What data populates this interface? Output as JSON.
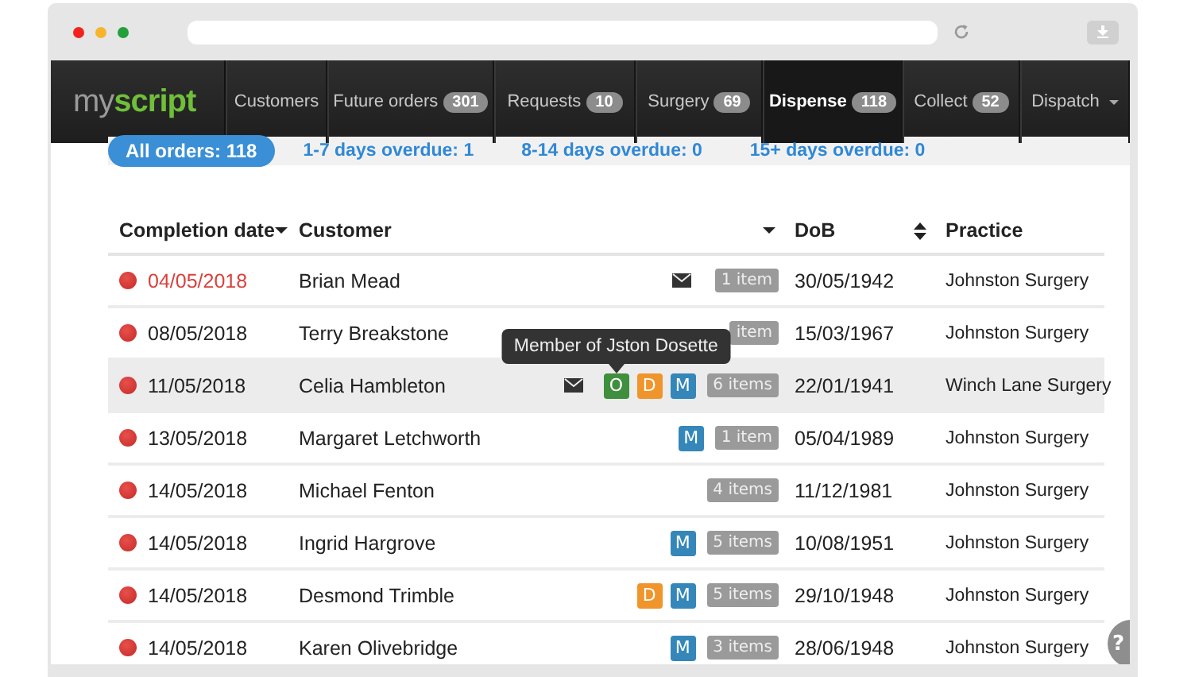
{
  "nav": {
    "logo": [
      "my",
      "script"
    ],
    "items": [
      {
        "label": "Customers",
        "selected": false
      },
      {
        "label": "Future orders",
        "count": "301",
        "selected": false
      },
      {
        "label": "Requests",
        "count": "10",
        "selected": false
      },
      {
        "label": "Surgery",
        "count": "69",
        "selected": false
      },
      {
        "label": "Dispense",
        "count": "118",
        "selected": true
      },
      {
        "label": "Collect",
        "count": "52",
        "selected": false
      },
      {
        "label": "Dispatch",
        "has_menu": true,
        "selected": false
      }
    ]
  },
  "filters": [
    {
      "label": "All orders: 118",
      "selected": true
    },
    {
      "label": "1-7 days overdue: 1",
      "selected": false
    },
    {
      "label": "8-14 days overdue: 0",
      "selected": false
    },
    {
      "label": "15+ days overdue: 0",
      "selected": false
    }
  ],
  "table": {
    "columns": [
      {
        "label": "Completion date",
        "sorted": true
      },
      {
        "label": "Customer",
        "sorted": true
      },
      {
        "label": "DoB",
        "sorted": false,
        "sortable": true
      },
      {
        "label": "Practice"
      }
    ],
    "rows": [
      {
        "date": "04/05/2018",
        "overdue": true,
        "customer": "Brian Mead",
        "mail": true,
        "tags": [],
        "items": "1 item",
        "dob": "30/05/1942",
        "practice": "Johnston Surgery",
        "highlighted": false
      },
      {
        "date": "08/05/2018",
        "overdue": false,
        "customer": "Terry Breakstone",
        "mail": false,
        "tags": [],
        "items": "item",
        "dob": "15/03/1967",
        "practice": "Johnston Surgery",
        "highlighted": false
      },
      {
        "date": "11/05/2018",
        "overdue": false,
        "customer": "Celia Hambleton",
        "mail": true,
        "tags": [
          {
            "letter": "O",
            "color": "#3f8f3f",
            "tooltip": "Member of Jston Dosette"
          },
          {
            "letter": "D",
            "color": "#f0952b"
          },
          {
            "letter": "M",
            "color": "#3487b8"
          }
        ],
        "items": "6 items",
        "dob": "22/01/1941",
        "practice": "Winch Lane Surgery",
        "highlighted": true
      },
      {
        "date": "13/05/2018",
        "overdue": false,
        "customer": "Margaret Letchworth",
        "mail": false,
        "tags": [
          {
            "letter": "M",
            "color": "#3487b8"
          }
        ],
        "items": "1 item",
        "dob": "05/04/1989",
        "practice": "Johnston Surgery",
        "highlighted": false
      },
      {
        "date": "14/05/2018",
        "overdue": false,
        "customer": "Michael Fenton",
        "mail": false,
        "tags": [],
        "items": "4 items",
        "dob": "11/12/1981",
        "practice": "Johnston Surgery",
        "highlighted": false
      },
      {
        "date": "14/05/2018",
        "overdue": false,
        "customer": "Ingrid Hargrove",
        "mail": false,
        "tags": [
          {
            "letter": "M",
            "color": "#3487b8"
          }
        ],
        "items": "5 items",
        "dob": "10/08/1951",
        "practice": "Johnston Surgery",
        "highlighted": false
      },
      {
        "date": "14/05/2018",
        "overdue": false,
        "customer": "Desmond Trimble",
        "mail": false,
        "tags": [
          {
            "letter": "D",
            "color": "#f0952b"
          },
          {
            "letter": "M",
            "color": "#3487b8"
          }
        ],
        "items": "5 items",
        "dob": "29/10/1948",
        "practice": "Johnston Surgery",
        "highlighted": false
      },
      {
        "date": "14/05/2018",
        "overdue": false,
        "customer": "Karen Olivebridge",
        "mail": false,
        "tags": [
          {
            "letter": "M",
            "color": "#3487b8"
          }
        ],
        "items": "3 items",
        "dob": "28/06/1948",
        "practice": "Johnston Surgery",
        "highlighted": false
      }
    ]
  },
  "help_button": "?"
}
